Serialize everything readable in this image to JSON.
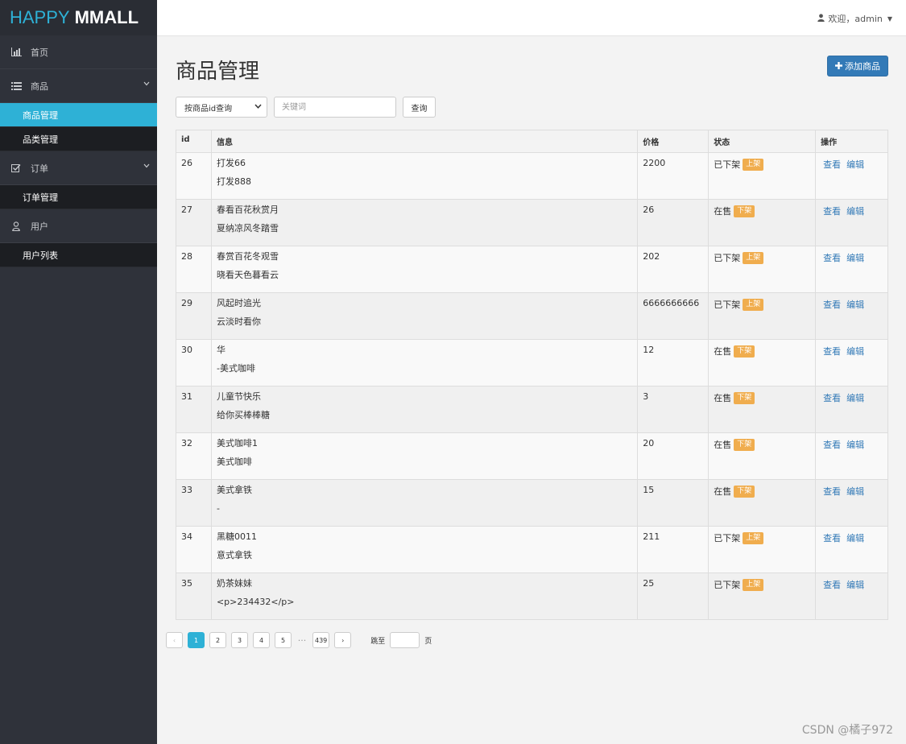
{
  "brand": {
    "part1": "HAPPY",
    "part2": "MMALL"
  },
  "sidebar": {
    "home": {
      "label": "首页",
      "icon": "bar-chart-icon"
    },
    "product": {
      "label": "商品",
      "icon": "list-icon",
      "items": [
        {
          "label": "商品管理"
        },
        {
          "label": "品类管理"
        }
      ]
    },
    "order": {
      "label": "订单",
      "icon": "check-square-icon",
      "items": [
        {
          "label": "订单管理"
        }
      ]
    },
    "user": {
      "label": "用户",
      "icon": "user-icon",
      "items": [
        {
          "label": "用户列表"
        }
      ]
    }
  },
  "header": {
    "greeting": "欢迎，admin"
  },
  "page": {
    "title": "商品管理",
    "add_button": "添加商品"
  },
  "search": {
    "select_value": "按商品id查询",
    "placeholder": "关键词",
    "button": "查询"
  },
  "table": {
    "headers": [
      "id",
      "信息",
      "价格",
      "状态",
      "操作"
    ],
    "view_label": "查看",
    "edit_label": "编辑",
    "rows": [
      {
        "id": "26",
        "name": "打发66",
        "subtitle": "打发888",
        "price": "2200",
        "status": "已下架",
        "action": "上架"
      },
      {
        "id": "27",
        "name": "春看百花秋赏月",
        "subtitle": "夏纳凉风冬踏雪",
        "price": "26",
        "status": "在售",
        "action": "下架"
      },
      {
        "id": "28",
        "name": "春赏百花冬观雪",
        "subtitle": "晓看天色暮看云",
        "price": "202",
        "status": "已下架",
        "action": "上架"
      },
      {
        "id": "29",
        "name": "风起时追光",
        "subtitle": "云淡时看你",
        "price": "6666666666",
        "status": "已下架",
        "action": "上架"
      },
      {
        "id": "30",
        "name": "华",
        "subtitle": "-美式咖啡",
        "price": "12",
        "status": "在售",
        "action": "下架"
      },
      {
        "id": "31",
        "name": "儿童节快乐",
        "subtitle": "给你买棒棒糖",
        "price": "3",
        "status": "在售",
        "action": "下架"
      },
      {
        "id": "32",
        "name": "美式咖啡1",
        "subtitle": "美式咖啡",
        "price": "20",
        "status": "在售",
        "action": "下架"
      },
      {
        "id": "33",
        "name": "美式拿铁",
        "subtitle": "-",
        "price": "15",
        "status": "在售",
        "action": "下架"
      },
      {
        "id": "34",
        "name": "黑糖0011",
        "subtitle": "意式拿铁",
        "price": "211",
        "status": "已下架",
        "action": "上架"
      },
      {
        "id": "35",
        "name": "奶茶妹妹",
        "subtitle": "<p>234432</p>",
        "price": "25",
        "status": "已下架",
        "action": "上架"
      }
    ]
  },
  "pagination": {
    "prev": "‹",
    "pages": [
      "1",
      "2",
      "3",
      "4",
      "5"
    ],
    "current": "1",
    "ellipsis": "···",
    "last": "439",
    "next": "›",
    "jump_label": "跳至",
    "jump_suffix": "页"
  },
  "watermark": "CSDN @橘子972",
  "colors": {
    "sidebar_bg": "#2f323a",
    "accent": "#2eb1d6",
    "primary": "#337ab7",
    "badge": "#f0ad4e"
  }
}
